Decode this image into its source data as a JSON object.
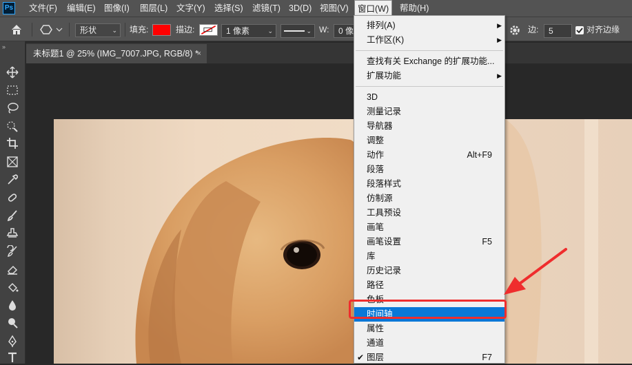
{
  "app": {
    "logo": "Ps"
  },
  "menubar": {
    "items": [
      "文件(F)",
      "编辑(E)",
      "图像(I)",
      "图层(L)",
      "文字(Y)",
      "选择(S)",
      "滤镜(T)",
      "3D(D)",
      "视图(V)",
      "窗口(W)",
      "帮助(H)"
    ],
    "active": "窗口(W)"
  },
  "options": {
    "home_icon": "home-icon",
    "shape_mode": "形状",
    "fill_label": "填充:",
    "fill_color": "#ff0000",
    "stroke_label": "描边:",
    "stroke_width": "1 像素",
    "w_label": "W:",
    "w_value": "0 像",
    "sides_label": "边:",
    "sides_value": "5",
    "align_edges": "对齐边缘",
    "align_checked": true
  },
  "tab": {
    "title": "未标题1 @ 25% (IMG_7007.JPG, RGB/8) *",
    "close": "×"
  },
  "tools": [
    "move-icon",
    "marquee-icon",
    "lasso-icon",
    "quick-select-icon",
    "crop-icon",
    "frame-icon",
    "eyedropper-icon",
    "healing-brush-icon",
    "brush-icon",
    "clone-stamp-icon",
    "history-brush-icon",
    "eraser-icon",
    "paint-bucket-icon",
    "blur-icon",
    "dodge-icon",
    "pen-icon",
    "type-icon"
  ],
  "window_menu": {
    "groups": [
      [
        {
          "label": "排列(A)",
          "submenu": true
        },
        {
          "label": "工作区(K)",
          "submenu": true
        }
      ],
      [
        {
          "label": "查找有关 Exchange 的扩展功能..."
        },
        {
          "label": "扩展功能",
          "submenu": true
        }
      ],
      [
        {
          "label": "3D"
        },
        {
          "label": "测量记录"
        },
        {
          "label": "导航器"
        },
        {
          "label": "调整"
        },
        {
          "label": "动作",
          "shortcut": "Alt+F9"
        },
        {
          "label": "段落"
        },
        {
          "label": "段落样式"
        },
        {
          "label": "仿制源"
        },
        {
          "label": "工具预设"
        },
        {
          "label": "画笔"
        },
        {
          "label": "画笔设置",
          "shortcut": "F5"
        },
        {
          "label": "库"
        },
        {
          "label": "历史记录"
        },
        {
          "label": "路径"
        },
        {
          "label": "色板"
        },
        {
          "label": "时间轴",
          "highlighted": true
        },
        {
          "label": "属性"
        },
        {
          "label": "通道"
        },
        {
          "label": "图层",
          "shortcut": "F7",
          "checked": true
        }
      ]
    ]
  },
  "annotation": {
    "color": "#ef2d2d"
  }
}
